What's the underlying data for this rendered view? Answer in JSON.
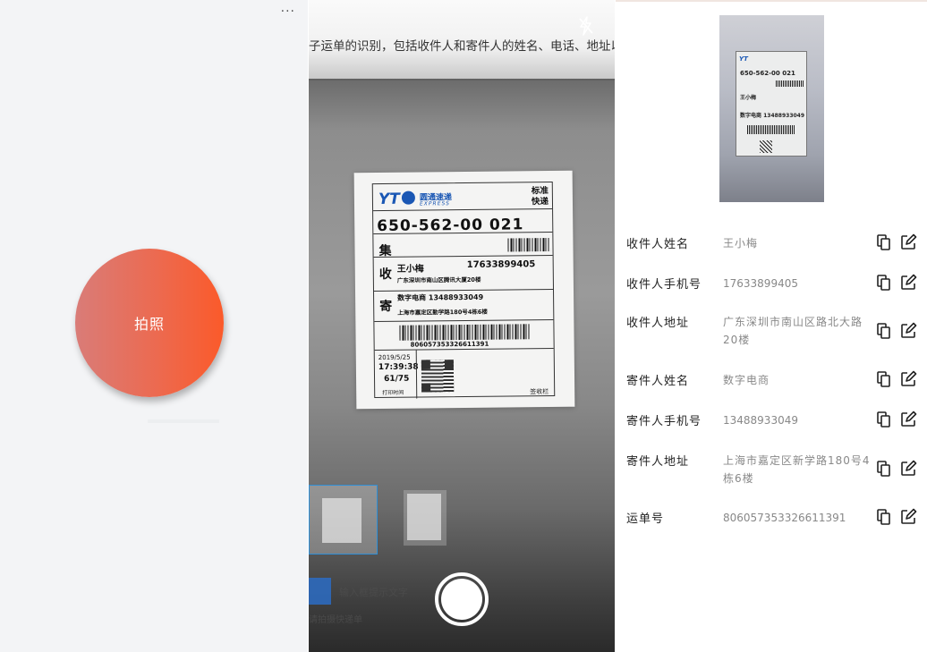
{
  "panel1": {
    "menu": "···",
    "shoot_button": "拍照"
  },
  "panel2": {
    "doc_text": "子运单的识别，包括收件人和寄件人的姓名、电话、地址以及",
    "label": {
      "brand_name": "圆通速递",
      "brand_en": "EXPRESS",
      "service_line1": "标准",
      "service_line2": "快递",
      "code": "650-562-00 021",
      "jibao": "集",
      "recv_side": "收",
      "recv_name": "王小梅",
      "recv_phone": "17633899405",
      "recv_address": "广东深圳市南山区腾讯大厦20楼",
      "send_side": "寄",
      "send_name_phone": "数字电商 13488933049",
      "send_address": "上海市嘉定区勤学路180号4栋6楼",
      "barcode_number": "806057353326611391",
      "print_date": "2019/5/25",
      "print_time": "17:39:38",
      "count": "61/75",
      "print_label": "打印时间",
      "sign_label": "签收栏"
    },
    "faint_text1": "输入框提示文字",
    "faint_text2": "请拍摄快递单"
  },
  "panel3": {
    "fields": [
      {
        "label": "收件人姓名",
        "value": "王小梅"
      },
      {
        "label": "收件人手机号",
        "value": "17633899405"
      },
      {
        "label": "收件人地址",
        "value": "广东深圳市南山区路北大路20楼"
      },
      {
        "label": "寄件人姓名",
        "value": "数字电商"
      },
      {
        "label": "寄件人手机号",
        "value": "13488933049"
      },
      {
        "label": "寄件人地址",
        "value": "上海市嘉定区新学路180号4栋6楼"
      },
      {
        "label": "运单号",
        "value": "806057353326611391"
      }
    ]
  },
  "colors": {
    "button_gradient_start": "#d97c78",
    "button_gradient_end": "#fb5a2a",
    "panel_bg": "#f3f4f6",
    "value_gray": "#888888"
  }
}
